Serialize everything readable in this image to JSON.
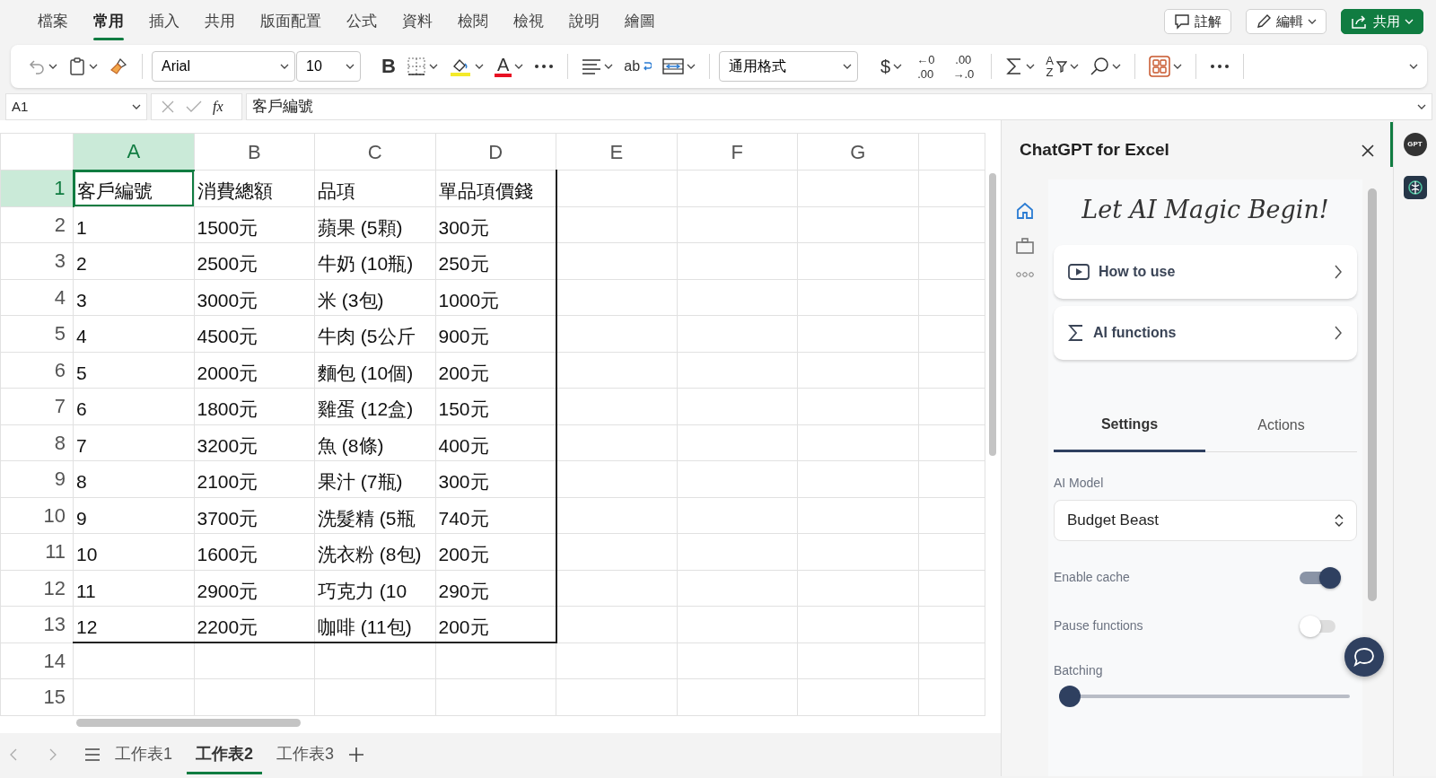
{
  "menu_tabs": [
    {
      "label": "檔案",
      "selected": false
    },
    {
      "label": "常用",
      "selected": true
    },
    {
      "label": "插入",
      "selected": false
    },
    {
      "label": "共用",
      "selected": false
    },
    {
      "label": "版面配置",
      "selected": false
    },
    {
      "label": "公式",
      "selected": false
    },
    {
      "label": "資料",
      "selected": false
    },
    {
      "label": "檢閱",
      "selected": false
    },
    {
      "label": "檢視",
      "selected": false
    },
    {
      "label": "說明",
      "selected": false
    },
    {
      "label": "繪圖",
      "selected": false
    }
  ],
  "header_buttons": [
    {
      "kind": "comment",
      "label": "註解"
    },
    {
      "kind": "edit",
      "label": "編輯"
    },
    {
      "kind": "share",
      "label": "共用"
    }
  ],
  "ribbon": [
    {
      "kind": "undo",
      "dropdown": true
    },
    {
      "kind": "paste",
      "dropdown": true
    },
    {
      "kind": "painter",
      "dropdown": false
    },
    {
      "kind": "separator"
    },
    {
      "kind": "font",
      "value": "Arial"
    },
    {
      "kind": "size",
      "value": "10"
    },
    {
      "kind": "bold",
      "glyph": "B",
      "dropdown": false
    },
    {
      "kind": "borders",
      "dropdown": true
    },
    {
      "kind": "fill",
      "dropdown": true
    },
    {
      "kind": "font_color",
      "glyph": "A",
      "dropdown": true
    },
    {
      "kind": "more",
      "dropdown": false
    },
    {
      "kind": "separator"
    },
    {
      "kind": "align",
      "dropdown": true
    },
    {
      "kind": "wrap",
      "glyph": "ab",
      "dropdown": false
    },
    {
      "kind": "merge",
      "dropdown": true
    },
    {
      "kind": "separator"
    },
    {
      "kind": "format",
      "value": "通用格式"
    },
    {
      "kind": "currency",
      "glyph": "$",
      "dropdown": true
    },
    {
      "kind": "decimal",
      "lines": [
        "←0",
        ".00"
      ],
      "dropdown": false
    },
    {
      "kind": "decimal",
      "lines": [
        ".00",
        "→.0"
      ],
      "dropdown": false
    },
    {
      "kind": "separator"
    },
    {
      "kind": "sum",
      "dropdown": true
    },
    {
      "kind": "sort",
      "lines": [
        "A",
        "Z"
      ],
      "dropdown": true
    },
    {
      "kind": "find",
      "dropdown": true
    },
    {
      "kind": "separator"
    },
    {
      "kind": "addins",
      "dropdown": true
    },
    {
      "kind": "separator"
    },
    {
      "kind": "more",
      "dropdown": false
    },
    {
      "kind": "separator"
    }
  ],
  "formula_bar": {
    "name_box": "A1",
    "fx": "fx",
    "formula": "客戶編號"
  },
  "sheet": {
    "columns": [
      {
        "label": "A",
        "selected": true
      },
      {
        "label": "B",
        "selected": false
      },
      {
        "label": "C",
        "selected": false
      },
      {
        "label": "D",
        "selected": false
      },
      {
        "label": "E",
        "selected": false
      },
      {
        "label": "F",
        "selected": false
      },
      {
        "label": "G",
        "selected": false
      }
    ],
    "rows": [
      {
        "number": "1",
        "selected": true,
        "cells": [
          "客戶編號",
          "消費總額",
          "品項",
          "單品項價錢"
        ]
      },
      {
        "number": "2",
        "selected": false,
        "cells": [
          "1",
          "1500元",
          "蘋果 (5顆)",
          "300元"
        ]
      },
      {
        "number": "3",
        "selected": false,
        "cells": [
          "2",
          "2500元",
          "牛奶 (10瓶)",
          "250元"
        ]
      },
      {
        "number": "4",
        "selected": false,
        "cells": [
          "3",
          "3000元",
          "米 (3包)",
          "1000元"
        ]
      },
      {
        "number": "5",
        "selected": false,
        "cells": [
          "4",
          "4500元",
          "牛肉 (5公斤",
          "900元"
        ]
      },
      {
        "number": "6",
        "selected": false,
        "cells": [
          "5",
          "2000元",
          "麵包 (10個)",
          "200元"
        ]
      },
      {
        "number": "7",
        "selected": false,
        "cells": [
          "6",
          "1800元",
          "雞蛋 (12盒)",
          "150元"
        ]
      },
      {
        "number": "8",
        "selected": false,
        "cells": [
          "7",
          "3200元",
          "魚 (8條)",
          "400元"
        ]
      },
      {
        "number": "9",
        "selected": false,
        "cells": [
          "8",
          "2100元",
          "果汁 (7瓶)",
          "300元"
        ]
      },
      {
        "number": "10",
        "selected": false,
        "cells": [
          "9",
          "3700元",
          "洗髮精 (5瓶",
          "740元"
        ]
      },
      {
        "number": "11",
        "selected": false,
        "cells": [
          "10",
          "1600元",
          "洗衣粉 (8包)",
          "200元"
        ]
      },
      {
        "number": "12",
        "selected": false,
        "cells": [
          "11",
          "2900元",
          "巧克力 (10",
          "290元"
        ]
      },
      {
        "number": "13",
        "selected": false,
        "cells": [
          "12",
          "2200元",
          "咖啡 (11包)",
          "200元"
        ]
      },
      {
        "number": "14",
        "selected": false,
        "cells": []
      },
      {
        "number": "15",
        "selected": false,
        "cells": []
      }
    ]
  },
  "sheet_tabs": [
    {
      "label": "工作表1",
      "selected": false
    },
    {
      "label": "工作表2",
      "selected": true
    },
    {
      "label": "工作表3",
      "selected": false
    }
  ],
  "panel": {
    "title": "ChatGPT for Excel",
    "tagline": "Let AI Magic Begin!",
    "nav": [
      {
        "kind": "home",
        "selected": true
      },
      {
        "kind": "briefcase",
        "selected": false
      },
      {
        "kind": "more",
        "selected": false
      }
    ],
    "cards": [
      {
        "kind": "video",
        "label": "How to use"
      },
      {
        "kind": "sigma",
        "label": "AI functions"
      }
    ],
    "tabs": [
      {
        "label": "Settings",
        "selected": true
      },
      {
        "label": "Actions",
        "selected": false
      }
    ],
    "model_label": "AI Model",
    "model": "Budget Beast",
    "toggles": [
      {
        "label": "Enable cache",
        "on": true
      },
      {
        "label": "Pause functions",
        "on": false
      }
    ],
    "batching": {
      "label": "Batching",
      "level": 0
    }
  },
  "side_strip": [
    {
      "kind": "gpt",
      "glyph": "GPT",
      "selected": true
    },
    {
      "kind": "addin",
      "selected": false
    }
  ]
}
